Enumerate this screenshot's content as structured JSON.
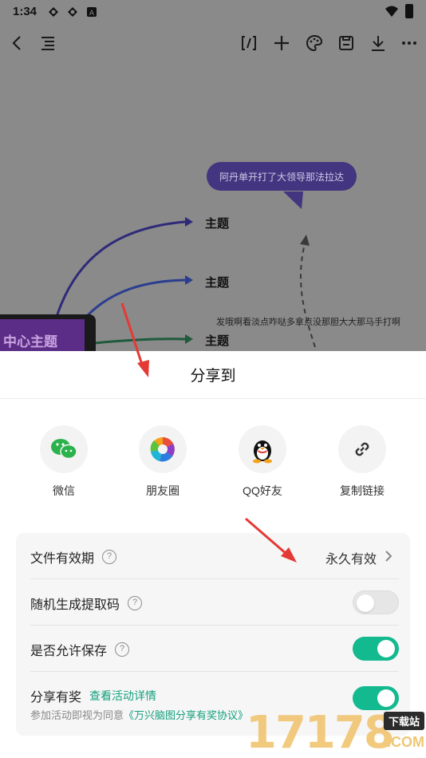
{
  "status_bar": {
    "time": "1:34"
  },
  "canvas": {
    "bubble_text": "阿丹单开打了大领导那法拉达",
    "topics": [
      "主题",
      "主题",
      "主题"
    ],
    "center_topic": "中心主题",
    "note": "发哦啊看淡点咋哒多拿点没那胆大大那马手打啊"
  },
  "sheet": {
    "title": "分享到",
    "share_targets": [
      {
        "label": "微信",
        "icon": "wechat-icon"
      },
      {
        "label": "朋友圈",
        "icon": "moments-icon"
      },
      {
        "label": "QQ好友",
        "icon": "qq-icon"
      },
      {
        "label": "复制链接",
        "icon": "link-icon"
      }
    ],
    "settings": {
      "expiry": {
        "label": "文件有效期",
        "value": "永久有效"
      },
      "random_code": {
        "label": "随机生成提取码",
        "enabled": false
      },
      "allow_save": {
        "label": "是否允许保存",
        "enabled": true
      },
      "share_reward": {
        "label": "分享有奖",
        "link": "查看活动详情",
        "sub_prefix": "参加活动即视为同意",
        "sub_agreement": "《万兴脑图分享有奖协议》",
        "enabled": true
      }
    }
  },
  "watermark": {
    "number": "17178",
    "tag": "下载站",
    "domain": ".COM"
  },
  "colors": {
    "accent": "#13b98f",
    "bubble": "#43357f",
    "center": "#5b2d86",
    "arrow": "#e53935"
  }
}
